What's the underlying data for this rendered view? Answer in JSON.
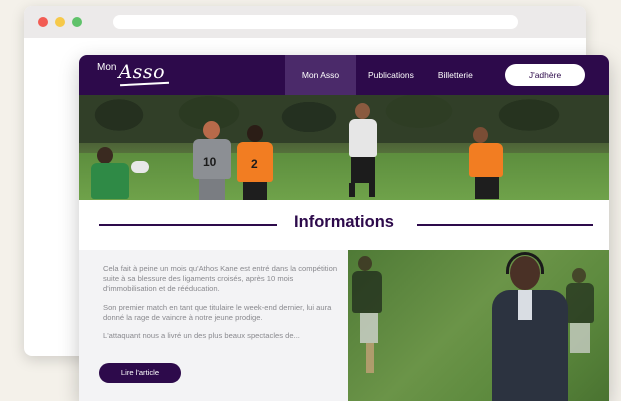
{
  "nav": {
    "logo_small": "Mon",
    "logo_script": "Asso",
    "links": [
      "Mon Asso",
      "Publications",
      "Billetterie"
    ],
    "join_label": "J'adhère"
  },
  "hero": {
    "jersey_numbers": [
      "10",
      "2"
    ]
  },
  "section": {
    "title": "Informations"
  },
  "article": {
    "paragraphs": [
      "Cela fait à peine un mois qu'Athos Kane est entré dans la compétition suite à sa blessure des ligaments croisés, après 10 mois d'immobilisation et de rééducation.",
      "Son premier match en tant que titulaire le week-end dernier, lui aura donné la rage de vaincre à notre jeune prodige.",
      "L'attaquant nous a livré un des plus beaux spectacles de..."
    ],
    "read_label": "Lire l'article"
  },
  "colors": {
    "brand": "#2d0a4b",
    "nav_active": "#4b2a6a",
    "page_bg": "#f4f1ea"
  }
}
